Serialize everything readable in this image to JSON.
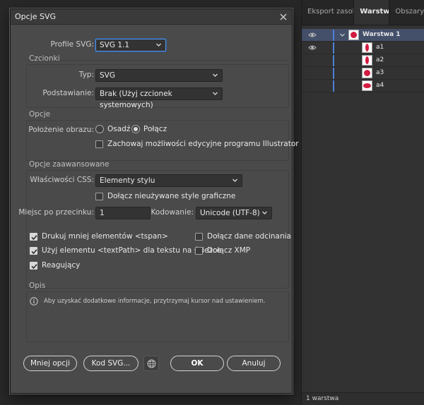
{
  "panel": {
    "tabs": [
      {
        "label": "Eksport zasobów",
        "active": false
      },
      {
        "label": "Warstwy",
        "active": true
      },
      {
        "label": "Obszary r",
        "active": false
      }
    ],
    "layers": [
      {
        "name": "Warstwa 1",
        "thumb": "circle",
        "selected": true,
        "visible": true,
        "expanded": true
      },
      {
        "name": "a1",
        "thumb": "tall",
        "selected": false,
        "visible": true
      },
      {
        "name": "a2",
        "thumb": "tall",
        "selected": false,
        "visible": false
      },
      {
        "name": "a3",
        "thumb": "circle",
        "selected": false,
        "visible": false
      },
      {
        "name": "a4",
        "thumb": "wide",
        "selected": false,
        "visible": false
      }
    ],
    "footer": "1  warstwa",
    "accent_color": "#4d7fd6",
    "artwork_color": "#d21c40"
  },
  "dialog": {
    "title": "Opcje SVG",
    "profile": {
      "label": "Profile SVG:",
      "value": "SVG 1.1"
    },
    "fonts": {
      "section": "Czcionki",
      "type_label": "Typ:",
      "type_value": "SVG",
      "subset_label": "Podstawianie:",
      "subset_value": "Brak (Użyj czcionek systemowych)"
    },
    "options": {
      "section": "Opcje",
      "image_label": "Położenie obrazu:",
      "embed_label": "Osadź",
      "link_label": "Połącz",
      "selected_location": "Połącz",
      "preserve_label": "Zachowaj możliwości edycyjne programu Illustrator",
      "preserve_checked": false
    },
    "advanced": {
      "section": "Opcje zaawansowane",
      "css_label": "Właściwości CSS:",
      "css_value": "Elementy stylu",
      "unused_styles_label": "Dołącz nieużywane style graficzne",
      "unused_styles_checked": false,
      "decimal_label": "Miejsc po przecinku:",
      "decimal_value": "1",
      "encoding_label": "Kodowanie:",
      "encoding_value": "Unicode (UTF-8)",
      "tspan_label": "Drukuj mniej elementów <tspan>",
      "tspan_checked": true,
      "textpath_label": "Użyj elementu <textPath> dla tekstu na ścieżce",
      "textpath_checked": true,
      "responsive_label": "Reagujący",
      "responsive_checked": true,
      "slicing_label": "Dołącz dane odcinania",
      "slicing_checked": false,
      "xmp_label": "Dołącz XMP",
      "xmp_checked": false
    },
    "description": {
      "section": "Opis",
      "text": "Aby uzyskać dodatkowe informacje, przytrzymaj kursor nad ustawieniem."
    },
    "buttons": {
      "less": "Mniej opcji",
      "svg_code": "Kod SVG...",
      "ok": "OK",
      "cancel": "Anuluj"
    }
  }
}
